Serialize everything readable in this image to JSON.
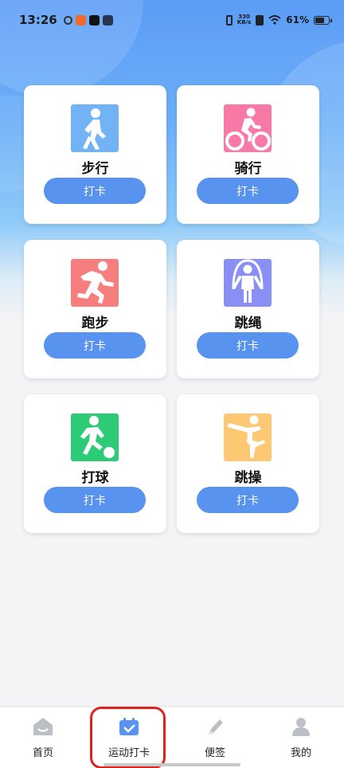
{
  "status_bar": {
    "time": "13:26",
    "net_speed_value": "330",
    "net_speed_unit": "KB/s",
    "battery": "61%",
    "battery_level": 0.61
  },
  "cards": [
    {
      "label": "步行",
      "button": "打卡",
      "icon": "walking-icon",
      "color": "#72b3f5"
    },
    {
      "label": "骑行",
      "button": "打卡",
      "icon": "cycling-icon",
      "color": "#f879a6"
    },
    {
      "label": "跑步",
      "button": "打卡",
      "icon": "running-icon",
      "color": "#f67e7e"
    },
    {
      "label": "跳绳",
      "button": "打卡",
      "icon": "jump-rope-icon",
      "color": "#8a8ff5"
    },
    {
      "label": "打球",
      "button": "打卡",
      "icon": "soccer-icon",
      "color": "#2ecb76"
    },
    {
      "label": "跳操",
      "button": "打卡",
      "icon": "aerobics-icon",
      "color": "#fcc873"
    }
  ],
  "tabbar": {
    "items": [
      {
        "label": "首页",
        "icon": "home-icon"
      },
      {
        "label": "运动打卡",
        "icon": "calendar-check-icon",
        "active": true
      },
      {
        "label": "便签",
        "icon": "pencil-icon"
      },
      {
        "label": "我的",
        "icon": "user-icon"
      }
    ],
    "accent": "#5793ef",
    "inactive": "#bcc0c6"
  }
}
